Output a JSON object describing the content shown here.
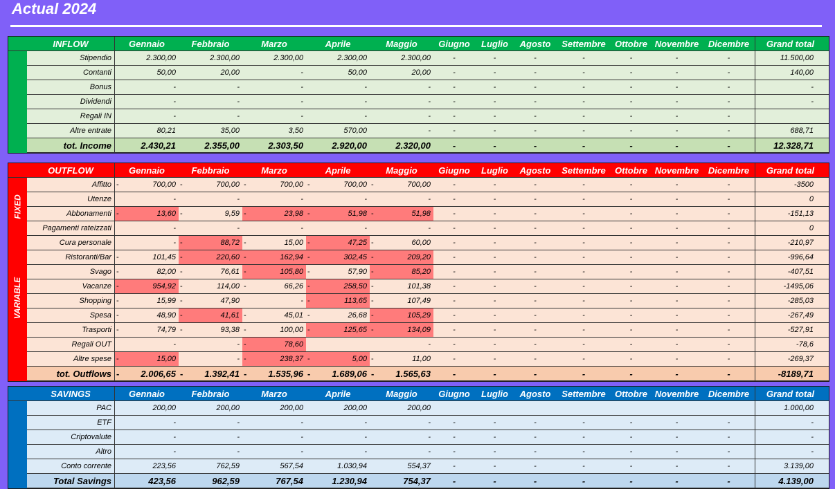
{
  "title": "Actual 2024",
  "months": [
    "Gennaio",
    "Febbraio",
    "Marzo",
    "Aprile",
    "Maggio",
    "Giugno",
    "Luglio",
    "Agosto",
    "Settembre",
    "Ottobre",
    "Novembre",
    "Dicembre"
  ],
  "grand_total_label": "Grand total",
  "colors": {
    "background": "#8060f8",
    "inflow_header": "#00b050",
    "inflow_body": "#e2efda",
    "outflow_header": "#ff0000",
    "outflow_body": "#fce4d6",
    "highlight": "#ff7b7b",
    "savings_header": "#0070c0",
    "savings_body": "#ddebf7"
  },
  "inflow": {
    "header": "INFLOW",
    "rows": [
      {
        "label": "Stipendio",
        "values": [
          "2.300,00",
          "2.300,00",
          "2.300,00",
          "2.300,00",
          "2.300,00",
          "-",
          "-",
          "-",
          "-",
          "-",
          "-",
          "-"
        ],
        "total": "11.500,00"
      },
      {
        "label": "Contanti",
        "values": [
          "50,00",
          "20,00",
          "-",
          "50,00",
          "20,00",
          "-",
          "-",
          "-",
          "-",
          "-",
          "-",
          "-"
        ],
        "total": "140,00"
      },
      {
        "label": "Bonus",
        "values": [
          "-",
          "-",
          "-",
          "-",
          "-",
          "-",
          "-",
          "-",
          "-",
          "-",
          "-",
          "-"
        ],
        "total": "-"
      },
      {
        "label": "Dividendi",
        "values": [
          "-",
          "-",
          "-",
          "-",
          "-",
          "-",
          "-",
          "-",
          "-",
          "-",
          "-",
          "-"
        ],
        "total": "-"
      },
      {
        "label": "Regali IN",
        "values": [
          "-",
          "-",
          "-",
          "-",
          "-",
          "-",
          "-",
          "-",
          "-",
          "-",
          "-",
          "-"
        ],
        "total": ""
      },
      {
        "label": "Altre entrate",
        "values": [
          "80,21",
          "35,00",
          "3,50",
          "570,00",
          "-",
          "-",
          "-",
          "-",
          "-",
          "-",
          "-",
          "-"
        ],
        "total": "688,71"
      }
    ],
    "total": {
      "label": "tot. Income",
      "values": [
        "2.430,21",
        "2.355,00",
        "2.303,50",
        "2.920,00",
        "2.320,00",
        "-",
        "-",
        "-",
        "-",
        "-",
        "-",
        "-"
      ],
      "total": "12.328,71"
    }
  },
  "outflow": {
    "header": "OUTFLOW",
    "fixed_label": "FIXED",
    "variable_label": "VARIABLE",
    "rows": [
      {
        "label": "Affitto",
        "values": [
          "700,00",
          "700,00",
          "700,00",
          "700,00",
          "700,00",
          "-",
          "-",
          "-",
          "-",
          "-",
          "-",
          "-"
        ],
        "neg": [
          1,
          1,
          1,
          1,
          1,
          0,
          0,
          0,
          0,
          0,
          0,
          0
        ],
        "hi": [
          0,
          0,
          0,
          0,
          0,
          0,
          0,
          0,
          0,
          0,
          0,
          0
        ],
        "total": "-3500"
      },
      {
        "label": "Utenze",
        "values": [
          "-",
          "-",
          "-",
          "-",
          "-",
          "-",
          "-",
          "-",
          "-",
          "-",
          "-",
          "-"
        ],
        "neg": [
          0,
          0,
          0,
          0,
          0,
          0,
          0,
          0,
          0,
          0,
          0,
          0
        ],
        "hi": [
          0,
          0,
          0,
          0,
          0,
          0,
          0,
          0,
          0,
          0,
          0,
          0
        ],
        "total": "0"
      },
      {
        "label": "Abbonamenti",
        "values": [
          "13,60",
          "9,59",
          "23,98",
          "51,98",
          "51,98",
          "-",
          "-",
          "-",
          "-",
          "-",
          "-",
          "-"
        ],
        "neg": [
          1,
          1,
          1,
          1,
          1,
          0,
          0,
          0,
          0,
          0,
          0,
          0
        ],
        "hi": [
          1,
          0,
          1,
          1,
          1,
          0,
          0,
          0,
          0,
          0,
          0,
          0
        ],
        "total": "-151,13"
      },
      {
        "label": "Pagamenti rateizzati",
        "values": [
          "-",
          "-",
          "-",
          "-",
          "-",
          "-",
          "-",
          "-",
          "-",
          "-",
          "-",
          "-"
        ],
        "neg": [
          0,
          0,
          0,
          0,
          0,
          0,
          0,
          0,
          0,
          0,
          0,
          0
        ],
        "hi": [
          0,
          0,
          0,
          0,
          0,
          0,
          0,
          0,
          0,
          0,
          0,
          0
        ],
        "total": "0"
      },
      {
        "label": "Cura personale",
        "values": [
          "-",
          "88,72",
          "15,00",
          "47,25",
          "60,00",
          "-",
          "-",
          "-",
          "-",
          "-",
          "-",
          "-"
        ],
        "neg": [
          0,
          1,
          1,
          1,
          1,
          0,
          0,
          0,
          0,
          0,
          0,
          0
        ],
        "hi": [
          0,
          1,
          0,
          1,
          0,
          0,
          0,
          0,
          0,
          0,
          0,
          0
        ],
        "total": "-210,97"
      },
      {
        "label": "Ristoranti/Bar",
        "values": [
          "101,45",
          "220,60",
          "162,94",
          "302,45",
          "209,20",
          "-",
          "-",
          "-",
          "-",
          "-",
          "-",
          "-"
        ],
        "neg": [
          1,
          1,
          1,
          1,
          1,
          0,
          0,
          0,
          0,
          0,
          0,
          0
        ],
        "hi": [
          0,
          1,
          1,
          1,
          1,
          0,
          0,
          0,
          0,
          0,
          0,
          0
        ],
        "total": "-996,64"
      },
      {
        "label": "Svago",
        "values": [
          "82,00",
          "76,61",
          "105,80",
          "57,90",
          "85,20",
          "-",
          "-",
          "-",
          "-",
          "-",
          "-",
          "-"
        ],
        "neg": [
          1,
          1,
          1,
          1,
          1,
          0,
          0,
          0,
          0,
          0,
          0,
          0
        ],
        "hi": [
          0,
          0,
          1,
          0,
          1,
          0,
          0,
          0,
          0,
          0,
          0,
          0
        ],
        "total": "-407,51"
      },
      {
        "label": "Vacanze",
        "values": [
          "954,92",
          "114,00",
          "66,26",
          "258,50",
          "101,38",
          "-",
          "-",
          "-",
          "-",
          "-",
          "-",
          "-"
        ],
        "neg": [
          1,
          1,
          1,
          1,
          1,
          0,
          0,
          0,
          0,
          0,
          0,
          0
        ],
        "hi": [
          1,
          0,
          0,
          1,
          0,
          0,
          0,
          0,
          0,
          0,
          0,
          0
        ],
        "total": "-1495,06"
      },
      {
        "label": "Shopping",
        "values": [
          "15,99",
          "47,90",
          "-",
          "113,65",
          "107,49",
          "-",
          "-",
          "-",
          "-",
          "-",
          "-",
          "-"
        ],
        "neg": [
          1,
          1,
          0,
          1,
          1,
          0,
          0,
          0,
          0,
          0,
          0,
          0
        ],
        "hi": [
          0,
          0,
          0,
          1,
          0,
          0,
          0,
          0,
          0,
          0,
          0,
          0
        ],
        "total": "-285,03"
      },
      {
        "label": "Spesa",
        "values": [
          "48,90",
          "41,61",
          "45,01",
          "26,68",
          "105,29",
          "-",
          "-",
          "-",
          "-",
          "-",
          "-",
          "-"
        ],
        "neg": [
          1,
          1,
          1,
          1,
          1,
          0,
          0,
          0,
          0,
          0,
          0,
          0
        ],
        "hi": [
          0,
          1,
          0,
          0,
          1,
          0,
          0,
          0,
          0,
          0,
          0,
          0
        ],
        "total": "-267,49"
      },
      {
        "label": "Trasporti",
        "values": [
          "74,79",
          "93,38",
          "100,00",
          "125,65",
          "134,09",
          "-",
          "-",
          "-",
          "-",
          "-",
          "-",
          "-"
        ],
        "neg": [
          1,
          1,
          1,
          1,
          1,
          0,
          0,
          0,
          0,
          0,
          0,
          0
        ],
        "hi": [
          0,
          0,
          0,
          1,
          1,
          0,
          0,
          0,
          0,
          0,
          0,
          0
        ],
        "total": "-527,91"
      },
      {
        "label": "Regali OUT",
        "values": [
          "-",
          "-",
          "78,60",
          "",
          "-",
          "-",
          "-",
          "-",
          "-",
          "-",
          "-",
          "-"
        ],
        "neg": [
          0,
          0,
          1,
          0,
          0,
          0,
          0,
          0,
          0,
          0,
          0,
          0
        ],
        "hi": [
          0,
          0,
          1,
          0,
          0,
          0,
          0,
          0,
          0,
          0,
          0,
          0
        ],
        "total": "-78,6"
      },
      {
        "label": "Altre spese",
        "values": [
          "15,00",
          "-",
          "238,37",
          "5,00",
          "11,00",
          "-",
          "-",
          "-",
          "-",
          "-",
          "-",
          "-"
        ],
        "neg": [
          1,
          0,
          1,
          1,
          1,
          0,
          0,
          0,
          0,
          0,
          0,
          0
        ],
        "hi": [
          1,
          0,
          1,
          1,
          0,
          0,
          0,
          0,
          0,
          0,
          0,
          0
        ],
        "total": "-269,37"
      }
    ],
    "total": {
      "label": "tot. Outflows",
      "values": [
        "2.006,65",
        "1.392,41",
        "1.535,96",
        "1.689,06",
        "1.565,63",
        "-",
        "-",
        "-",
        "-",
        "-",
        "-",
        "-"
      ],
      "neg": [
        1,
        1,
        1,
        1,
        1,
        0,
        0,
        0,
        0,
        0,
        0,
        0
      ],
      "total": "-8189,71"
    }
  },
  "savings": {
    "header": "SAVINGS",
    "rows": [
      {
        "label": "PAC",
        "values": [
          "200,00",
          "200,00",
          "200,00",
          "200,00",
          "200,00",
          "",
          "",
          "",
          "",
          "",
          "",
          ""
        ],
        "total": "1.000,00"
      },
      {
        "label": "ETF",
        "values": [
          "-",
          "-",
          "-",
          "-",
          "-",
          "-",
          "-",
          "-",
          "-",
          "-",
          "-",
          "-"
        ],
        "total": "-"
      },
      {
        "label": "Criptovalute",
        "values": [
          "-",
          "-",
          "-",
          "-",
          "-",
          "-",
          "-",
          "-",
          "-",
          "-",
          "-",
          "-"
        ],
        "total": "-"
      },
      {
        "label": "Altro",
        "values": [
          "-",
          "-",
          "-",
          "-",
          "-",
          "-",
          "-",
          "-",
          "-",
          "-",
          "-",
          "-"
        ],
        "total": "-"
      },
      {
        "label": "Conto corrente",
        "values": [
          "223,56",
          "762,59",
          "567,54",
          "1.030,94",
          "554,37",
          "-",
          "-",
          "-",
          "-",
          "-",
          "-",
          "-"
        ],
        "total": "3.139,00"
      }
    ],
    "total": {
      "label": "Total Savings",
      "values": [
        "423,56",
        "962,59",
        "767,54",
        "1.230,94",
        "754,37",
        "-",
        "-",
        "-",
        "-",
        "-",
        "-",
        "-"
      ],
      "total": "4.139,00"
    }
  }
}
